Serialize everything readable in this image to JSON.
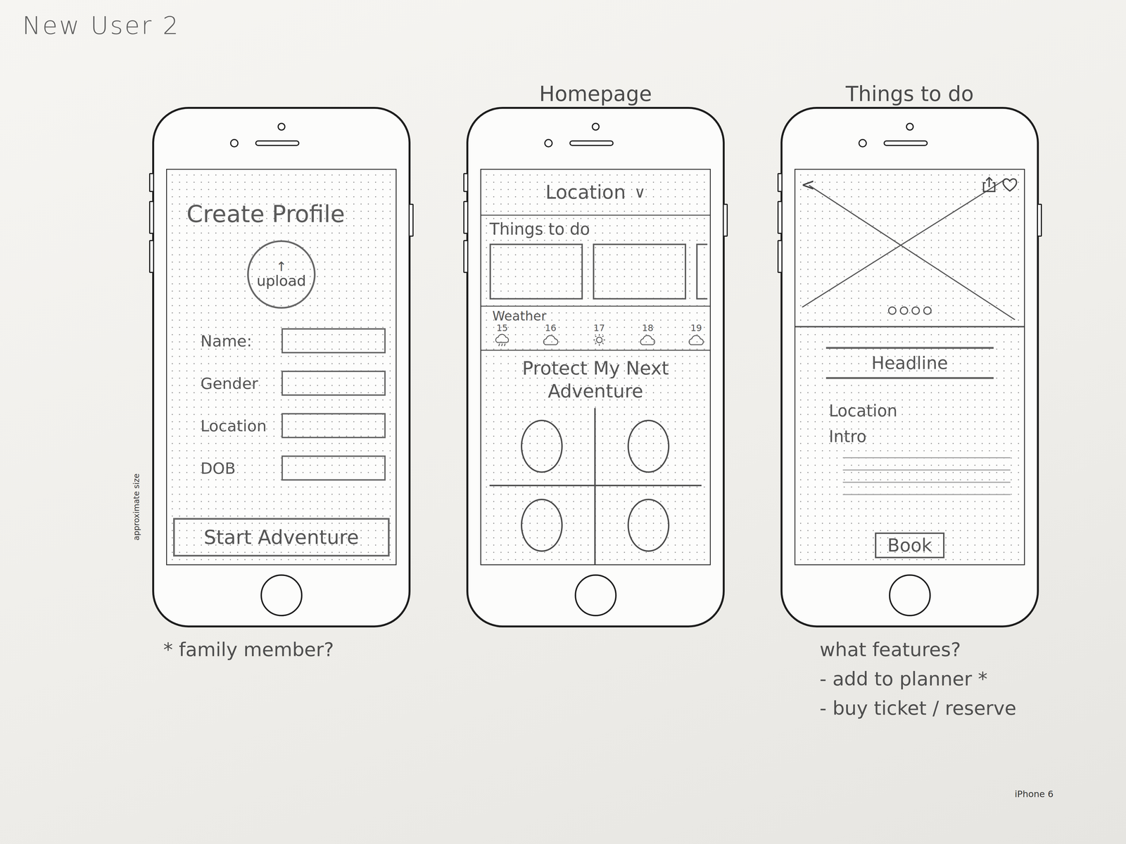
{
  "title": "New User 2",
  "side_note": "approximate size",
  "model": "iPhone 6",
  "screens": [
    {
      "kind": "profile",
      "heading": "Create Profile",
      "upload": {
        "icon": "↑",
        "label": "upload"
      },
      "fields": [
        {
          "label": "Name:",
          "value": ""
        },
        {
          "label": "Gender",
          "value": ""
        },
        {
          "label": "Location",
          "value": ""
        },
        {
          "label": "DOB",
          "value": ""
        }
      ],
      "button": "Start Adventure",
      "notes": [
        "* family member?"
      ]
    },
    {
      "kind": "home",
      "label": "Homepage",
      "location": {
        "label": "Location",
        "caret": "∨"
      },
      "things_to_do": {
        "title": "Things to do",
        "cards": [
          {
            "kind": "full"
          },
          {
            "kind": "full"
          },
          {
            "kind": "partial"
          }
        ]
      },
      "weather": {
        "title": "Weather",
        "days": [
          {
            "day": "15",
            "kind": "rain"
          },
          {
            "day": "16",
            "kind": "cloud"
          },
          {
            "day": "17",
            "kind": "sun"
          },
          {
            "day": "18",
            "kind": "cloud"
          },
          {
            "day": "19",
            "kind": "cloud"
          }
        ]
      },
      "protect": {
        "title": "Protect My Next Adventure",
        "tiles": [
          {
            "kind": "oval"
          },
          {
            "kind": "oval"
          },
          {
            "kind": "oval"
          },
          {
            "kind": "oval"
          }
        ]
      },
      "notes": []
    },
    {
      "kind": "detail",
      "label": "Things to do",
      "back": "<",
      "carousel": [
        {
          "selected": false
        },
        {
          "selected": false
        },
        {
          "selected": false
        },
        {
          "selected": false
        }
      ],
      "headline": "Headline",
      "location": "Location",
      "intro": "Intro",
      "button": "Book",
      "notes": [
        "what features?",
        "- add to planner *",
        "- buy ticket / reserve"
      ]
    }
  ]
}
